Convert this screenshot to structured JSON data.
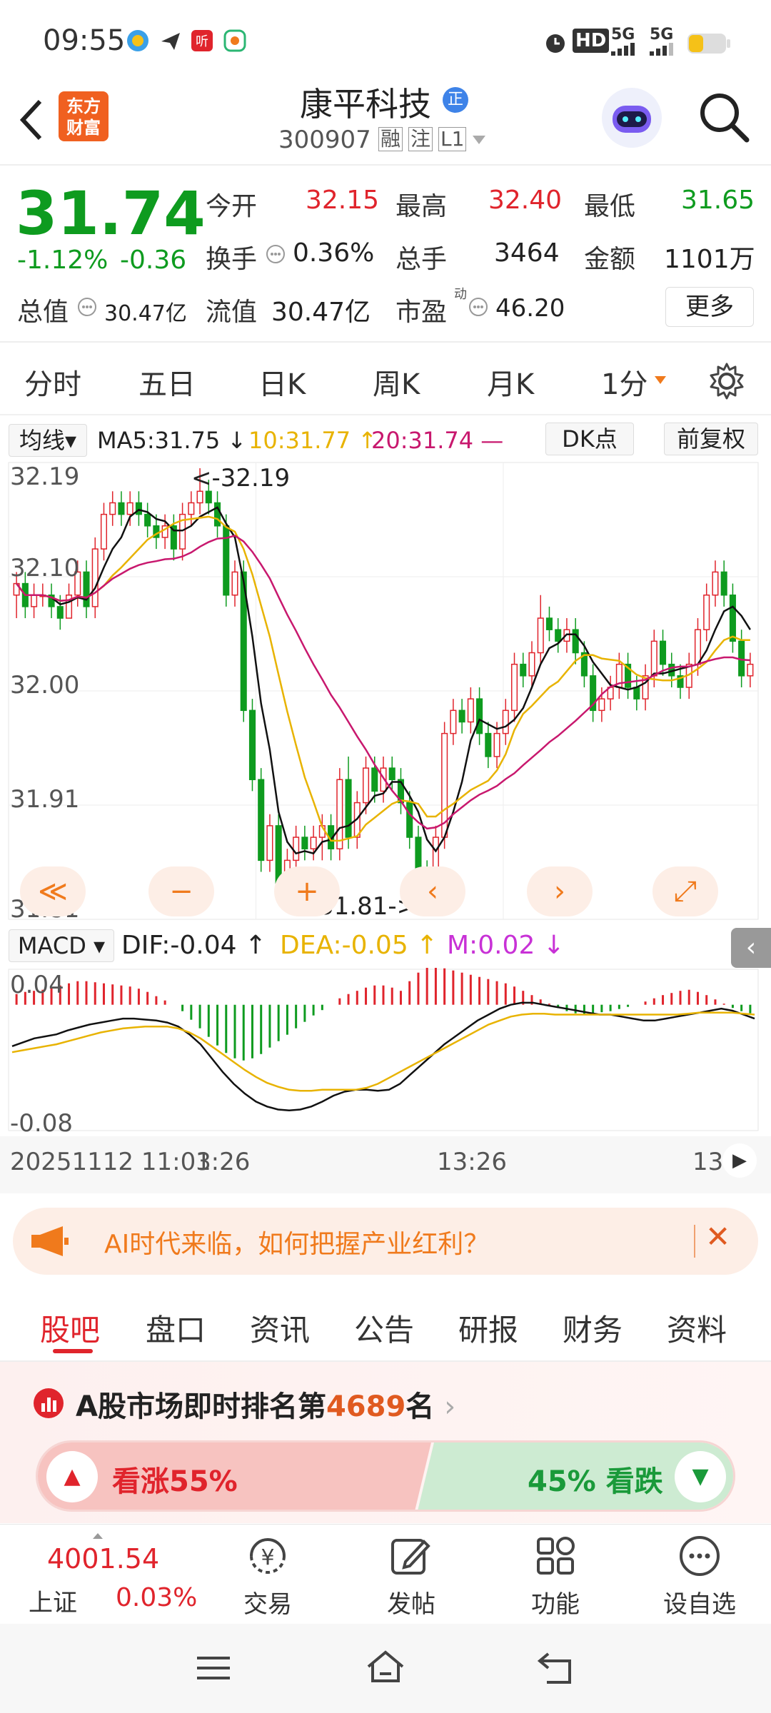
{
  "status_bar": {
    "time": "09:55",
    "icons": [
      "app-icon",
      "send-icon",
      "listen-app-icon",
      "promo-icon",
      "alarm-icon",
      "hd-icon",
      "signal-5g-icon",
      "signal-5g-icon",
      "battery-icon"
    ],
    "hd_label": "HD",
    "net1": "5G",
    "net2": "5G"
  },
  "header": {
    "back_icon": "chevron-left-icon",
    "logo_line1": "东方",
    "logo_line2": "财富",
    "stock_name": "康平科技",
    "badge": "正",
    "code": "300907",
    "tag1": "融",
    "tag2": "注",
    "tag3": "L1",
    "search_icon": "search-icon"
  },
  "quote": {
    "price": "31.74",
    "change_pct": "-1.12%",
    "change": "-0.36",
    "open_label": "今开",
    "open": "32.15",
    "high_label": "最高",
    "high": "32.40",
    "low_label": "最低",
    "low": "31.65",
    "turnover_label": "换手",
    "turnover": "0.36%",
    "volume_label": "总手",
    "volume": "3464",
    "amount_label": "金额",
    "amount": "1101万",
    "mcap_label": "总值",
    "mcap": "30.47亿",
    "float_label": "流值",
    "float": "30.47亿",
    "pe_label": "市盈",
    "pe_sup": "动",
    "pe": "46.20",
    "more_label": "更多"
  },
  "chart_tabs": [
    "分时",
    "五日",
    "日K",
    "周K",
    "月K",
    "1分"
  ],
  "indicators": {
    "ma_select": "均线",
    "ma5": "MA5:31.75 ↓",
    "ma10": "10:31.77 ↑",
    "ma20": "20:31.74 —",
    "dk_label": "DK点",
    "adjust_label": "前复权",
    "macd_select": "MACD",
    "dif": "DIF:-0.04 ↑",
    "dea": "DEA:-0.05 ↑",
    "m": "M:0.02 ↓"
  },
  "chart_data": {
    "type": "candlestick",
    "y_ticks": [
      "32.19",
      "32.10",
      "32.00",
      "31.91",
      "31.81"
    ],
    "ylim": [
      31.81,
      32.19
    ],
    "max_annotation": "<-32.19",
    "min_annotation": "31.81->",
    "macd_ticks": [
      "0.04",
      "-0.08"
    ],
    "x_labels": [
      "20251112 11:03",
      "1:26",
      "13:26",
      "13"
    ],
    "candles": [
      {
        "o": 32.08,
        "c": 32.09,
        "h": 32.1,
        "l": 32.06
      },
      {
        "o": 32.09,
        "c": 32.07,
        "h": 32.1,
        "l": 32.06
      },
      {
        "o": 32.07,
        "c": 32.08,
        "h": 32.09,
        "l": 32.06
      },
      {
        "o": 32.08,
        "c": 32.08,
        "h": 32.09,
        "l": 32.07
      },
      {
        "o": 32.08,
        "c": 32.07,
        "h": 32.09,
        "l": 32.06
      },
      {
        "o": 32.07,
        "c": 32.06,
        "h": 32.08,
        "l": 32.05
      },
      {
        "o": 32.06,
        "c": 32.08,
        "h": 32.09,
        "l": 32.06
      },
      {
        "o": 32.08,
        "c": 32.1,
        "h": 32.11,
        "l": 32.07
      },
      {
        "o": 32.1,
        "c": 32.07,
        "h": 32.11,
        "l": 32.06
      },
      {
        "o": 32.07,
        "c": 32.12,
        "h": 32.13,
        "l": 32.06
      },
      {
        "o": 32.12,
        "c": 32.15,
        "h": 32.16,
        "l": 32.11
      },
      {
        "o": 32.15,
        "c": 32.16,
        "h": 32.17,
        "l": 32.14
      },
      {
        "o": 32.16,
        "c": 32.15,
        "h": 32.17,
        "l": 32.14
      },
      {
        "o": 32.15,
        "c": 32.16,
        "h": 32.17,
        "l": 32.14
      },
      {
        "o": 32.16,
        "c": 32.15,
        "h": 32.17,
        "l": 32.14
      },
      {
        "o": 32.15,
        "c": 32.14,
        "h": 32.16,
        "l": 32.13
      },
      {
        "o": 32.14,
        "c": 32.13,
        "h": 32.15,
        "l": 32.12
      },
      {
        "o": 32.13,
        "c": 32.14,
        "h": 32.15,
        "l": 32.12
      },
      {
        "o": 32.14,
        "c": 32.12,
        "h": 32.15,
        "l": 32.11
      },
      {
        "o": 32.12,
        "c": 32.15,
        "h": 32.16,
        "l": 32.11
      },
      {
        "o": 32.15,
        "c": 32.16,
        "h": 32.17,
        "l": 32.14
      },
      {
        "o": 32.16,
        "c": 32.17,
        "h": 32.19,
        "l": 32.15
      },
      {
        "o": 32.17,
        "c": 32.16,
        "h": 32.18,
        "l": 32.15
      },
      {
        "o": 32.16,
        "c": 32.14,
        "h": 32.17,
        "l": 32.13
      },
      {
        "o": 32.14,
        "c": 32.08,
        "h": 32.15,
        "l": 32.07
      },
      {
        "o": 32.08,
        "c": 32.1,
        "h": 32.11,
        "l": 32.07
      },
      {
        "o": 32.1,
        "c": 31.98,
        "h": 32.11,
        "l": 31.97
      },
      {
        "o": 31.98,
        "c": 31.92,
        "h": 31.99,
        "l": 31.91
      },
      {
        "o": 31.92,
        "c": 31.85,
        "h": 31.93,
        "l": 31.84
      },
      {
        "o": 31.85,
        "c": 31.88,
        "h": 31.89,
        "l": 31.84
      },
      {
        "o": 31.88,
        "c": 31.83,
        "h": 31.89,
        "l": 31.82
      },
      {
        "o": 31.83,
        "c": 31.85,
        "h": 31.86,
        "l": 31.82
      },
      {
        "o": 31.85,
        "c": 31.87,
        "h": 31.88,
        "l": 31.84
      },
      {
        "o": 31.87,
        "c": 31.86,
        "h": 31.88,
        "l": 31.85
      },
      {
        "o": 31.86,
        "c": 31.87,
        "h": 31.88,
        "l": 31.85
      },
      {
        "o": 31.87,
        "c": 31.88,
        "h": 31.89,
        "l": 31.85
      },
      {
        "o": 31.88,
        "c": 31.86,
        "h": 31.89,
        "l": 31.85
      },
      {
        "o": 31.86,
        "c": 31.92,
        "h": 31.93,
        "l": 31.85
      },
      {
        "o": 31.92,
        "c": 31.87,
        "h": 31.94,
        "l": 31.86
      },
      {
        "o": 31.87,
        "c": 31.9,
        "h": 31.91,
        "l": 31.86
      },
      {
        "o": 31.9,
        "c": 31.93,
        "h": 31.94,
        "l": 31.89
      },
      {
        "o": 31.93,
        "c": 31.91,
        "h": 31.94,
        "l": 31.9
      },
      {
        "o": 31.91,
        "c": 31.93,
        "h": 31.94,
        "l": 31.9
      },
      {
        "o": 31.93,
        "c": 31.92,
        "h": 31.94,
        "l": 31.91
      },
      {
        "o": 31.92,
        "c": 31.9,
        "h": 31.93,
        "l": 31.89
      },
      {
        "o": 31.9,
        "c": 31.87,
        "h": 31.91,
        "l": 31.86
      },
      {
        "o": 31.87,
        "c": 31.84,
        "h": 31.88,
        "l": 31.83
      },
      {
        "o": 31.84,
        "c": 31.81,
        "h": 31.85,
        "l": 31.81
      },
      {
        "o": 31.81,
        "c": 31.87,
        "h": 31.88,
        "l": 31.81
      },
      {
        "o": 31.87,
        "c": 31.96,
        "h": 31.97,
        "l": 31.86
      },
      {
        "o": 31.96,
        "c": 31.98,
        "h": 31.99,
        "l": 31.95
      },
      {
        "o": 31.98,
        "c": 31.97,
        "h": 31.99,
        "l": 31.96
      },
      {
        "o": 31.97,
        "c": 31.99,
        "h": 32.0,
        "l": 31.96
      },
      {
        "o": 31.99,
        "c": 31.96,
        "h": 32.0,
        "l": 31.95
      },
      {
        "o": 31.96,
        "c": 31.94,
        "h": 31.97,
        "l": 31.93
      },
      {
        "o": 31.94,
        "c": 31.96,
        "h": 31.97,
        "l": 31.93
      },
      {
        "o": 31.96,
        "c": 31.98,
        "h": 31.99,
        "l": 31.95
      },
      {
        "o": 31.98,
        "c": 32.02,
        "h": 32.03,
        "l": 31.97
      },
      {
        "o": 32.02,
        "c": 32.01,
        "h": 32.03,
        "l": 32.0
      },
      {
        "o": 32.01,
        "c": 32.03,
        "h": 32.04,
        "l": 32.0
      },
      {
        "o": 32.03,
        "c": 32.06,
        "h": 32.08,
        "l": 32.02
      },
      {
        "o": 32.06,
        "c": 32.05,
        "h": 32.07,
        "l": 32.04
      },
      {
        "o": 32.05,
        "c": 32.04,
        "h": 32.06,
        "l": 32.03
      },
      {
        "o": 32.04,
        "c": 32.05,
        "h": 32.06,
        "l": 32.03
      },
      {
        "o": 32.05,
        "c": 32.03,
        "h": 32.06,
        "l": 32.02
      },
      {
        "o": 32.03,
        "c": 32.01,
        "h": 32.04,
        "l": 32.0
      },
      {
        "o": 32.01,
        "c": 31.98,
        "h": 32.02,
        "l": 31.97
      },
      {
        "o": 31.98,
        "c": 31.99,
        "h": 32.0,
        "l": 31.97
      },
      {
        "o": 31.99,
        "c": 32.0,
        "h": 32.01,
        "l": 31.98
      },
      {
        "o": 32.0,
        "c": 32.02,
        "h": 32.03,
        "l": 31.99
      },
      {
        "o": 32.02,
        "c": 32.0,
        "h": 32.03,
        "l": 31.99
      },
      {
        "o": 32.0,
        "c": 31.99,
        "h": 32.01,
        "l": 31.98
      },
      {
        "o": 31.99,
        "c": 32.01,
        "h": 32.02,
        "l": 31.98
      },
      {
        "o": 32.01,
        "c": 32.04,
        "h": 32.05,
        "l": 32.0
      },
      {
        "o": 32.04,
        "c": 32.02,
        "h": 32.05,
        "l": 32.01
      },
      {
        "o": 32.02,
        "c": 32.01,
        "h": 32.03,
        "l": 32.0
      },
      {
        "o": 32.01,
        "c": 32.0,
        "h": 32.02,
        "l": 31.99
      },
      {
        "o": 32.0,
        "c": 32.02,
        "h": 32.03,
        "l": 31.99
      },
      {
        "o": 32.02,
        "c": 32.05,
        "h": 32.06,
        "l": 32.01
      },
      {
        "o": 32.05,
        "c": 32.08,
        "h": 32.09,
        "l": 32.04
      },
      {
        "o": 32.08,
        "c": 32.1,
        "h": 32.11,
        "l": 32.07
      },
      {
        "o": 32.1,
        "c": 32.08,
        "h": 32.11,
        "l": 32.07
      },
      {
        "o": 32.08,
        "c": 32.04,
        "h": 32.09,
        "l": 32.03
      },
      {
        "o": 32.04,
        "c": 32.01,
        "h": 32.05,
        "l": 32.0
      },
      {
        "o": 32.01,
        "c": 32.02,
        "h": 32.03,
        "l": 32.0
      }
    ],
    "macd_hist": [
      0.01,
      0.012,
      0.013,
      0.014,
      0.016,
      0.018,
      0.02,
      0.022,
      0.022,
      0.021,
      0.02,
      0.019,
      0.018,
      0.017,
      0.015,
      0.012,
      0.008,
      0.004,
      0.0,
      -0.006,
      -0.014,
      -0.022,
      -0.03,
      -0.038,
      -0.045,
      -0.05,
      -0.052,
      -0.05,
      -0.046,
      -0.04,
      -0.034,
      -0.028,
      -0.022,
      -0.016,
      -0.01,
      -0.005,
      0.0,
      0.006,
      0.01,
      0.013,
      0.016,
      0.018,
      0.018,
      0.016,
      0.013,
      0.022,
      0.03,
      0.035,
      0.036,
      0.034,
      0.032,
      0.03,
      0.028,
      0.026,
      0.024,
      0.022,
      0.02,
      0.017,
      0.013,
      0.009,
      0.005,
      0.001,
      -0.003,
      -0.006,
      -0.008,
      -0.009,
      -0.008,
      -0.007,
      -0.006,
      -0.004,
      -0.002,
      0.0,
      0.003,
      0.006,
      0.009,
      0.011,
      0.013,
      0.014,
      0.012,
      0.009,
      0.005,
      0.001,
      -0.003,
      -0.006,
      -0.008
    ],
    "dif": [
      -0.022,
      -0.018,
      -0.014,
      -0.012,
      -0.01,
      -0.006,
      -0.003,
      0.0,
      0.002,
      0.004,
      0.006,
      0.006,
      0.005,
      0.004,
      0.002,
      -0.002,
      -0.01,
      -0.02,
      -0.034,
      -0.048,
      -0.06,
      -0.07,
      -0.078,
      -0.083,
      -0.086,
      -0.087,
      -0.086,
      -0.083,
      -0.078,
      -0.072,
      -0.068,
      -0.066,
      -0.066,
      -0.067,
      -0.066,
      -0.06,
      -0.05,
      -0.04,
      -0.03,
      -0.02,
      -0.012,
      -0.004,
      0.004,
      0.01,
      0.016,
      0.02,
      0.022,
      0.022,
      0.02,
      0.018,
      0.016,
      0.014,
      0.012,
      0.01,
      0.01,
      0.008,
      0.006,
      0.004,
      0.004,
      0.006,
      0.008,
      0.01,
      0.012,
      0.014,
      0.016,
      0.014,
      0.01,
      0.006
    ],
    "dea": [
      -0.028,
      -0.026,
      -0.024,
      -0.022,
      -0.02,
      -0.017,
      -0.014,
      -0.011,
      -0.008,
      -0.006,
      -0.004,
      -0.003,
      -0.002,
      -0.002,
      -0.002,
      -0.004,
      -0.008,
      -0.014,
      -0.022,
      -0.03,
      -0.038,
      -0.046,
      -0.053,
      -0.059,
      -0.063,
      -0.066,
      -0.067,
      -0.067,
      -0.066,
      -0.066,
      -0.066,
      -0.066,
      -0.064,
      -0.06,
      -0.054,
      -0.048,
      -0.042,
      -0.036,
      -0.03,
      -0.024,
      -0.018,
      -0.012,
      -0.006,
      0.0,
      0.004,
      0.008,
      0.01,
      0.011,
      0.011,
      0.01,
      0.01,
      0.01,
      0.01,
      0.01,
      0.01,
      0.01,
      0.01,
      0.01,
      0.01,
      0.01,
      0.01,
      0.011,
      0.012,
      0.012,
      0.012,
      0.012,
      0.011,
      0.01
    ]
  },
  "chart_nav": [
    "≪",
    "−",
    "+",
    "‹",
    "›",
    "⤢"
  ],
  "banner": {
    "text": "AI时代来临，如何把握产业红利？",
    "icon": "megaphone-icon",
    "close": "✕"
  },
  "content_tabs": [
    "股吧",
    "盘口",
    "资讯",
    "公告",
    "研报",
    "财务",
    "资料"
  ],
  "rank": {
    "prefix": "A股市场即时排名第",
    "num": "4689",
    "suffix": "名",
    "icon": "rank-chart-icon"
  },
  "sentiment": {
    "up_label": "看涨",
    "up_pct": "55%",
    "down_pct": "45%",
    "down_label": "看跌",
    "up_fraction": 0.55
  },
  "bottom_nav": {
    "index_value": "4001.54",
    "index_name": "上证",
    "index_change": "0.03%",
    "items": [
      {
        "label": "交易",
        "icon": "trade-yen-icon"
      },
      {
        "label": "发帖",
        "icon": "edit-post-icon"
      },
      {
        "label": "功能",
        "icon": "grid-function-icon"
      },
      {
        "label": "设自选",
        "icon": "more-dots-icon"
      }
    ]
  },
  "colors": {
    "up": "#e0242c",
    "down": "#0e9b1f",
    "accent": "#f07a1c",
    "ma5": "#111111",
    "ma10": "#e8b300",
    "ma20": "#c8186e"
  }
}
